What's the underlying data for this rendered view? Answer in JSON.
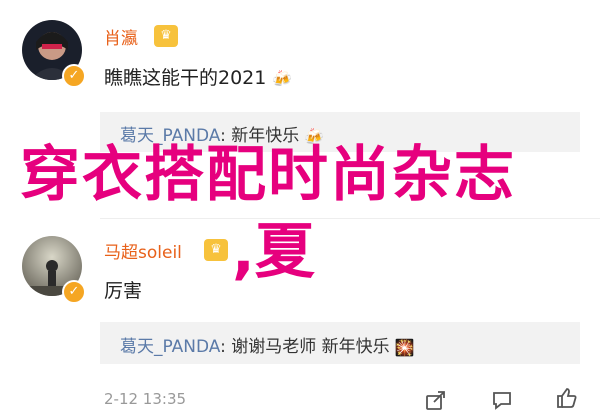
{
  "comments": [
    {
      "username": "肖瀛",
      "text": "瞧瞧这能干的2021",
      "reply": {
        "name": "葛天_PANDA",
        "sep": ":",
        "text": " 新年快乐"
      }
    },
    {
      "username": "马超soleil",
      "text": "厉害",
      "reply": {
        "name": "葛天_PANDA",
        "sep": ":",
        "text": " 谢谢马老师 新年快乐"
      }
    }
  ],
  "footer": {
    "time": "2-12 13:35"
  },
  "overlay": {
    "line1": "穿衣搭配时尚杂志",
    "line2": ",夏"
  },
  "icons": {
    "verified": "verified-badge-icon",
    "vip": "vip-crown-icon",
    "beer": "beer-emoji-icon",
    "sparkle": "sparkle-emoji-icon",
    "share": "share-icon",
    "comment": "comment-icon",
    "like": "like-icon"
  },
  "colors": {
    "username": "#e8611a",
    "reply_name": "#5b7aa8",
    "overlay": "#e6007e"
  }
}
